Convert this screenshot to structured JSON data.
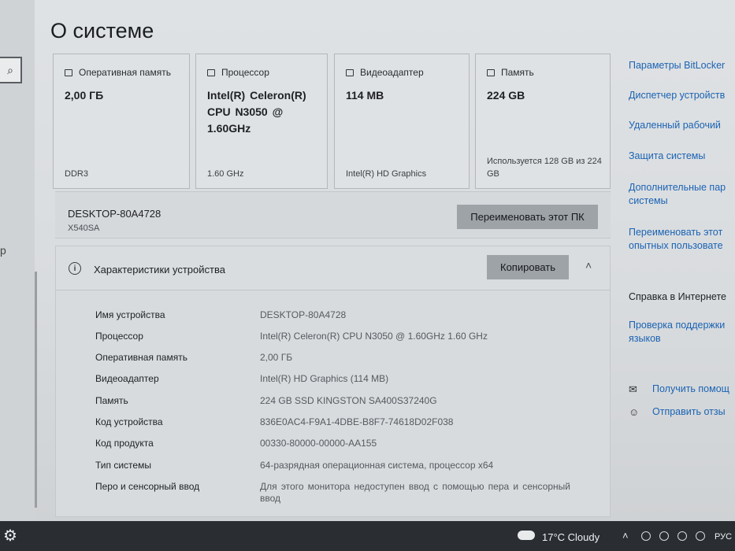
{
  "page": {
    "title": "О системе"
  },
  "cards": [
    {
      "name": "memory-card",
      "icon": "ram-icon",
      "label": "Оперативная память",
      "value": "2,00 ГБ",
      "footer": "DDR3"
    },
    {
      "name": "processor-card",
      "icon": "cpu-icon",
      "label": "Процессор",
      "value": "Intel(R) Celeron(R) CPU  N3050  @ 1.60GHz",
      "footer": "1.60 GHz"
    },
    {
      "name": "gpu-card",
      "icon": "monitor-icon",
      "label": "Видеоадаптер",
      "value": "114 MB",
      "footer": "Intel(R) HD Graphics"
    },
    {
      "name": "storage-card",
      "icon": "disk-icon",
      "label": "Память",
      "value": "224 GB",
      "footer": "Используется 128 GB из 224 GB"
    }
  ],
  "device": {
    "name": "DESKTOP-80A4728",
    "model": "X540SA",
    "rename_button": "Переименовать этот ПК"
  },
  "specs": {
    "icon": "info-icon",
    "title": "Характеристики устройства",
    "copy_button": "Копировать",
    "collapse_icon": "chevron-up-icon",
    "rows": [
      {
        "key": "Имя устройства",
        "value": "DESKTOP-80A4728"
      },
      {
        "key": "Процессор",
        "value": "Intel(R) Celeron(R) CPU  N3050  @ 1.60GHz   1.60 GHz"
      },
      {
        "key": "Оперативная память",
        "value": "2,00 ГБ"
      },
      {
        "key": "Видеоадаптер",
        "value": "Intel(R) HD Graphics (114 MB)"
      },
      {
        "key": "Память",
        "value": "224 GB SSD KINGSTON SA400S37240G"
      },
      {
        "key": "Код устройства",
        "value": "836E0AC4-F9A1-4DBE-B8F7-74618D02F038"
      },
      {
        "key": "Код продукта",
        "value": "00330-80000-00000-AA155"
      },
      {
        "key": "Тип системы",
        "value": "64-разрядная операционная система, процессор x64"
      },
      {
        "key": "Перо и сенсорный ввод",
        "value": "Для этого монитора недоступен ввод с помощью пера и сенсорный ввод"
      }
    ]
  },
  "related_links": [
    "Параметры BitLocker",
    "Диспетчер устройств",
    "Удаленный рабочий",
    "Защита системы",
    "Дополнительные пар",
    "системы",
    "Переименовать этот",
    "опытных пользовате"
  ],
  "help": {
    "heading": "Справка в Интернете",
    "link_line1": "Проверка поддержки",
    "link_line2": "языков",
    "get_help": "Получить помощ",
    "get_help_icon": "chat-help-icon",
    "feedback": "Отправить отзы",
    "feedback_icon": "feedback-icon"
  },
  "left": {
    "search_icon": "search-icon",
    "letter": "р"
  },
  "taskbar": {
    "settings_icon": "gear-icon",
    "weather_icon": "cloud-icon",
    "weather": "17°C  Cloudy",
    "language": "РУС"
  }
}
